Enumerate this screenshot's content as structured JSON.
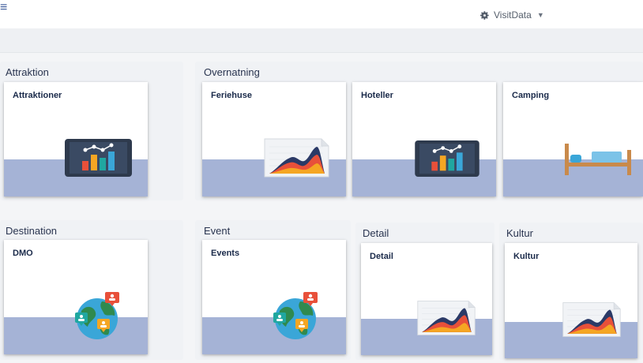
{
  "header": {
    "menu_icon": "hamburger-icon",
    "user_icon": "gear-icon",
    "user_label": "VisitData",
    "dropdown_icon": "caret-down-icon"
  },
  "groups": {
    "attraktion": {
      "label": "Attraktion",
      "tiles": [
        {
          "title": "Attraktioner",
          "icon": "tablet-bar-chart-icon"
        }
      ]
    },
    "overnatning": {
      "label": "Overnatning",
      "tiles": [
        {
          "title": "Feriehuse",
          "icon": "area-chart-icon"
        },
        {
          "title": "Hoteller",
          "icon": "tablet-bar-chart-icon"
        },
        {
          "title": "Camping",
          "icon": "bed-icon"
        }
      ]
    },
    "destination": {
      "label": "Destination",
      "tiles": [
        {
          "title": "DMO",
          "icon": "globe-chat-icon"
        }
      ]
    },
    "event": {
      "label": "Event",
      "tiles": [
        {
          "title": "Events",
          "icon": "globe-chat-icon"
        }
      ]
    },
    "detail": {
      "label": "Detail",
      "tiles": [
        {
          "title": "Detail",
          "icon": "area-chart-icon"
        }
      ]
    },
    "kultur": {
      "label": "Kultur",
      "tiles": [
        {
          "title": "Kultur",
          "icon": "area-chart-icon"
        }
      ]
    }
  },
  "colors": {
    "band": "#a5b3d6",
    "title_text": "#1a2a4a",
    "chart_red": "#e8503a",
    "chart_orange": "#f5a623",
    "chart_teal": "#20a7a0",
    "chart_navy": "#2b3a67",
    "tablet": "#2e3a4d"
  }
}
